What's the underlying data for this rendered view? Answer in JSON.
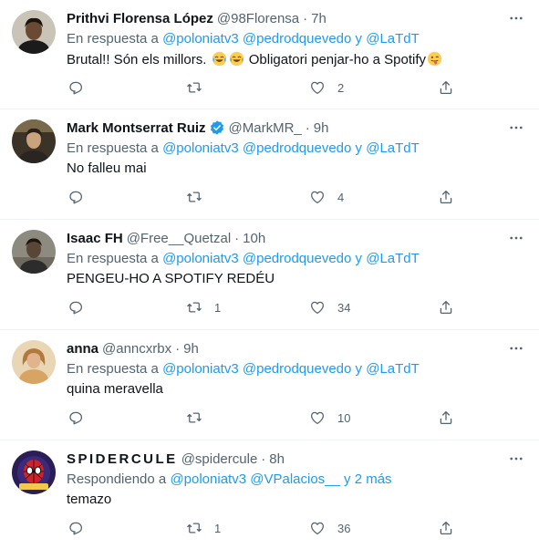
{
  "tweets": [
    {
      "name": "Prithvi Florensa López",
      "handle": "@98Florensa",
      "dot": "·",
      "time": "7h",
      "reply_prefix": "En respuesta a",
      "mentions": [
        "@poloniatv3",
        "@pedrodquevedo"
      ],
      "conj": "y",
      "last": "@LaTdT",
      "text_a": "Brutal!! Són els millors.",
      "text_b": "Obligatori penjar-ho a Spotify",
      "replies": "",
      "retweets": "",
      "likes": "2",
      "verified": false,
      "avatar": {
        "bg": "#c9c3b8",
        "skin": "#6b4a33",
        "shirt": "#1b1b1b",
        "hair": "#1a1411"
      }
    },
    {
      "name": "Mark Montserrat Ruiz",
      "handle": "@MarkMR_",
      "dot": "·",
      "time": "9h",
      "reply_prefix": "En respuesta a",
      "mentions": [
        "@poloniatv3",
        "@pedrodquevedo"
      ],
      "conj": "y",
      "last": "@LaTdT",
      "text": "No falleu mai",
      "replies": "",
      "retweets": "",
      "likes": "4",
      "verified": true,
      "avatar": {
        "bg": "#3b3327",
        "skin": "#c9a27e",
        "shirt": "#2a2520",
        "hair": "#2b2016"
      }
    },
    {
      "name": "Isaac FH",
      "handle": "@Free__Quetzal",
      "dot": "·",
      "time": "10h",
      "reply_prefix": "En respuesta a",
      "mentions": [
        "@poloniatv3",
        "@pedrodquevedo"
      ],
      "conj": "y",
      "last": "@LaTdT",
      "text": "PENGEU-HO A SPOTIFY REDÉU",
      "replies": "",
      "retweets": "1",
      "likes": "34",
      "verified": false,
      "avatar": {
        "bg": "#8d8a80",
        "skin": "#5a4636",
        "shirt": "#2c2c2c",
        "hair": "#1d1712"
      }
    },
    {
      "name": "anna",
      "handle": "@anncxrbx",
      "dot": "·",
      "time": "9h",
      "reply_prefix": "En respuesta a",
      "mentions": [
        "@poloniatv3",
        "@pedrodquevedo"
      ],
      "conj": "y",
      "last": "@LaTdT",
      "text": "quina meravella",
      "replies": "",
      "retweets": "",
      "likes": "10",
      "verified": false,
      "avatar": {
        "bg": "#e8d6b5",
        "skin": "#e2b48e",
        "shirt": "#d8a463",
        "hair": "#b07a3e"
      }
    },
    {
      "name": "SPIDERCULE",
      "handle": "@spidercule",
      "dot": "·",
      "time": "8h",
      "reply_prefix": "Respondiendo a",
      "mentions": [
        "@poloniatv3",
        "@VPalacios__"
      ],
      "conj": "y",
      "last": "2 más",
      "text": "temazo",
      "replies": "",
      "retweets": "1",
      "likes": "36",
      "verified": false,
      "avatar": {
        "bg": "#2a1d58",
        "skin": "#d3212c",
        "shirt": "#101010",
        "hair": "#f2c94c"
      }
    }
  ],
  "icons": {
    "more": "more-horizontal-icon",
    "reply": "reply-icon",
    "retweet": "retweet-icon",
    "like": "heart-icon",
    "share": "share-icon",
    "verified": "verified-badge-icon",
    "emoji_laugh": "face-with-tears-of-joy-icon",
    "emoji_tongue": "winking-face-with-tongue-icon"
  },
  "colors": {
    "accent": "#1d9bf0",
    "secondary_text": "#536471",
    "primary_text": "#0f1419",
    "divider": "#eff3f4"
  }
}
